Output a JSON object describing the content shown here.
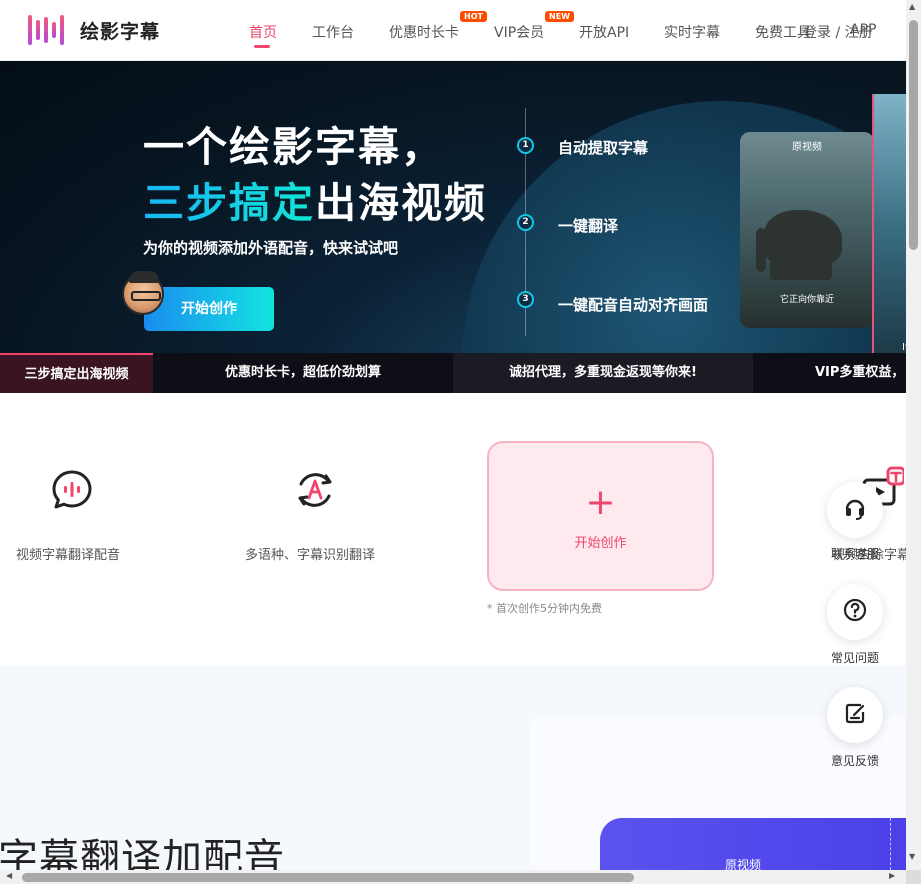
{
  "brand": {
    "name": "绘影字幕",
    "accent": "#f0466b"
  },
  "nav": {
    "items": [
      {
        "label": "首页",
        "active": true
      },
      {
        "label": "工作台"
      },
      {
        "label": "优惠时长卡",
        "badge": "HOT"
      },
      {
        "label": "VIP会员",
        "badge": "NEW"
      },
      {
        "label": "开放API"
      },
      {
        "label": "实时字幕"
      },
      {
        "label": "免费工具"
      }
    ],
    "login": "登录 / 注册",
    "extra": "APP"
  },
  "hero": {
    "title_line1": "一个绘影字幕，",
    "title_line2_highlight": "三步搞定",
    "title_line2_rest": "出海视频",
    "subtitle": "为你的视频添加外语配音，快来试试吧",
    "cta": "开始创作",
    "steps": [
      {
        "num": "1",
        "label": "自动提取字幕"
      },
      {
        "num": "2",
        "label": "一键翻译"
      },
      {
        "num": "3",
        "label": "一键配音自动对齐画面"
      }
    ],
    "card_tag": "原视频",
    "card_caption": "它正向你靠近",
    "card2_text": "It"
  },
  "ticker": [
    "三步搞定出海视频",
    "优惠时长卡，超低价劲划算",
    "诚招代理，多重现金返现等你来!",
    "VIP多重权益，"
  ],
  "features": [
    {
      "icon": "voice-bubble-icon",
      "label": "视频字幕翻译配音"
    },
    {
      "icon": "translate-cycle-icon",
      "label": "多语种、字幕识别翻译"
    }
  ],
  "create_card": {
    "plus": "+",
    "label": "开始创作",
    "note": "* 首次创作5分钟内免费"
  },
  "feature4": {
    "label": "视频去除字幕",
    "overlay": "联系客服"
  },
  "float_buttons": [
    {
      "icon": "headset-icon",
      "label": "联系客服"
    },
    {
      "icon": "question-icon",
      "label": "常见问题"
    },
    {
      "icon": "feedback-icon",
      "label": "意见反馈"
    }
  ],
  "lower": {
    "title": "字幕翻译加配音",
    "orig_label": "原视频"
  }
}
